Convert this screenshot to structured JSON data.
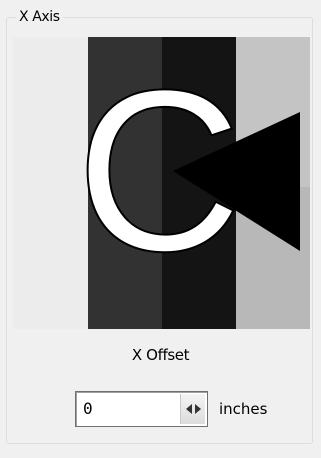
{
  "group": {
    "title": "X Axis"
  },
  "preview": {
    "letter": "C"
  },
  "offset": {
    "label": "X Offset",
    "value": "0",
    "units": "inches",
    "spin_icon": "left-right-arrows-icon"
  }
}
